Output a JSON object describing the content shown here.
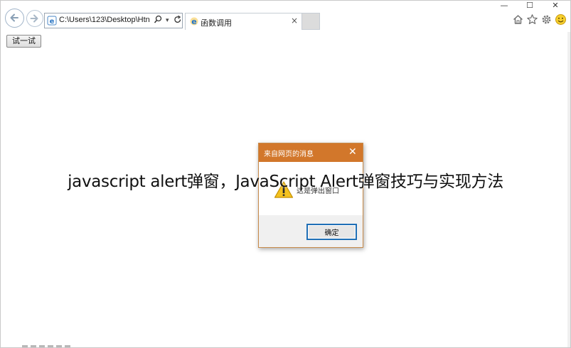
{
  "browser": {
    "address": "C:\\Users\\123\\Desktop\\Htn",
    "tab_title": "函数调用",
    "tab_close_glyph": "×",
    "window_controls": {
      "minimize": "—",
      "maximize": "☐",
      "close": "✕"
    },
    "icons": {
      "back": "back-arrow-icon",
      "forward": "forward-arrow-icon",
      "search": "search-icon",
      "refresh": "refresh-icon",
      "home": "home-icon",
      "favorites": "star-icon",
      "settings": "gear-icon",
      "feedback": "smiley-icon"
    }
  },
  "page": {
    "button_label": "试一试"
  },
  "dialog": {
    "title": "来自网页的消息",
    "close_glyph": "✕",
    "message": "这是弹出窗口",
    "ok_label": "确定",
    "title_color": "#d2772b",
    "ok_border_color": "#1f6fb6"
  },
  "caption": "javascript alert弹窗，JavaScript Alert弹窗技巧与实现方法"
}
